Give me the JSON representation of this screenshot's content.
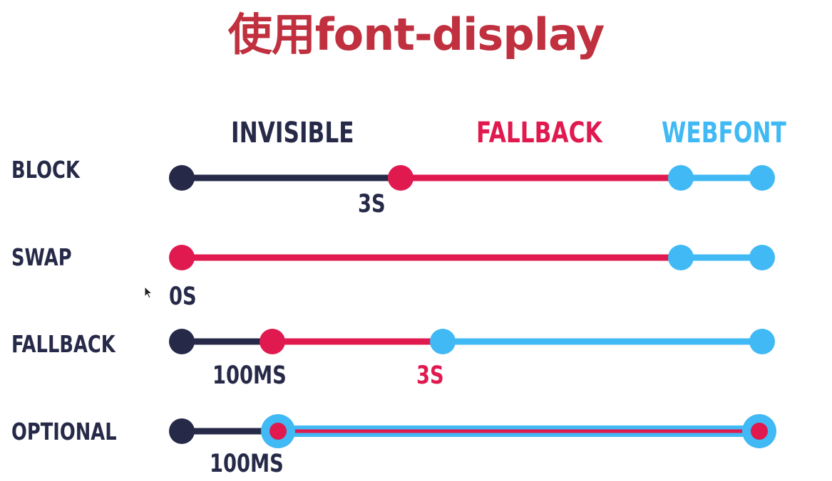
{
  "title": "使用font-display",
  "colors": {
    "invisible": "#262a48",
    "fallback": "#e0194f",
    "webfont": "#40b9f5",
    "title": "#c0303f"
  },
  "legend": {
    "invisible": "INVISIBLE",
    "fallback": "FALLBACK",
    "webfont": "WEBFONT"
  },
  "rows": [
    {
      "label": "BLOCK",
      "time_labels": [
        {
          "text": "3S",
          "color": "invisible"
        }
      ]
    },
    {
      "label": "SWAP",
      "time_labels": [
        {
          "text": "0S",
          "color": "invisible"
        }
      ]
    },
    {
      "label": "FALLBACK",
      "time_labels": [
        {
          "text": "100MS",
          "color": "invisible"
        },
        {
          "text": "3S",
          "color": "fallback"
        }
      ]
    },
    {
      "label": "OPTIONAL",
      "time_labels": [
        {
          "text": "100MS",
          "color": "invisible"
        }
      ]
    }
  ]
}
